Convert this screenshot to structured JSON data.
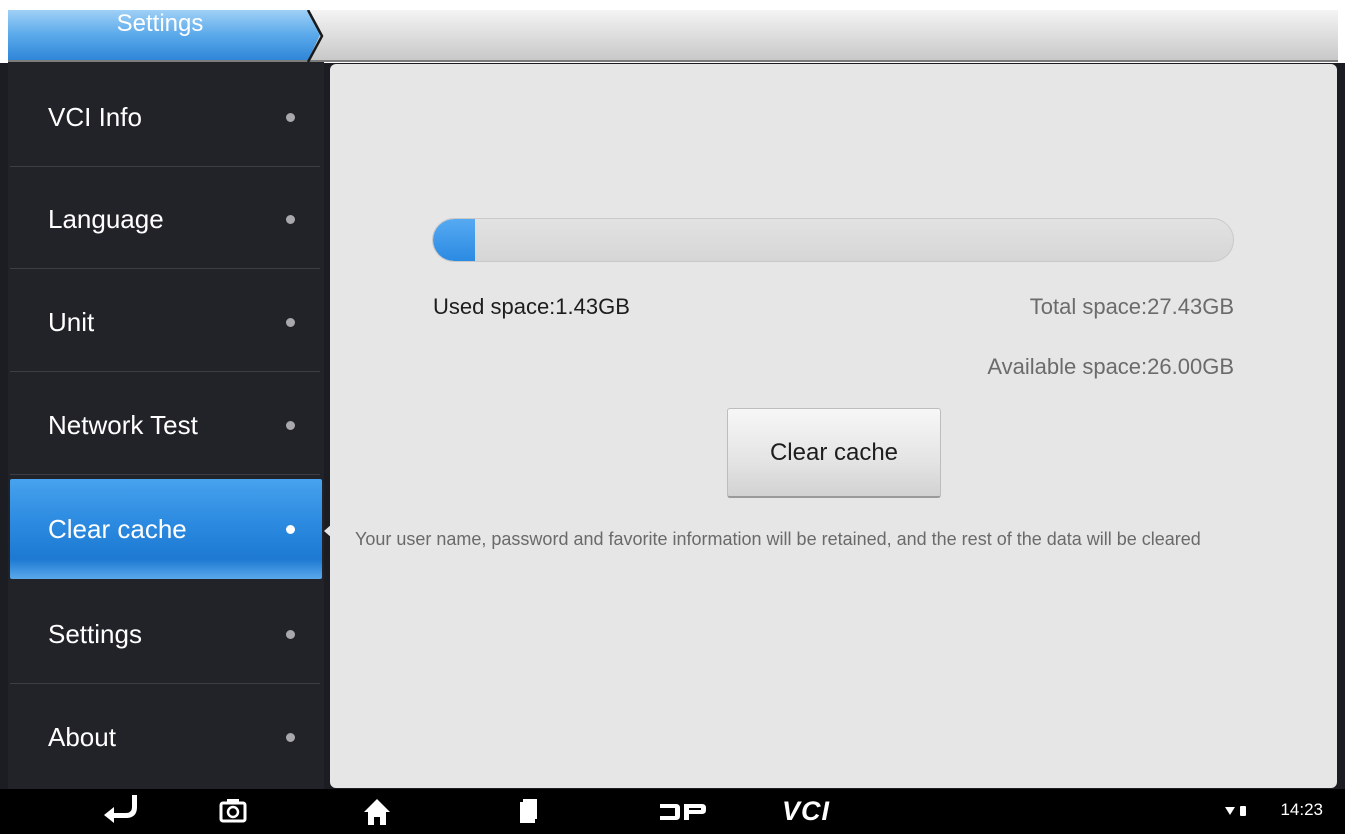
{
  "header": {
    "tab_label": "Settings"
  },
  "sidebar": {
    "items": [
      {
        "label": "VCI Info"
      },
      {
        "label": "Language"
      },
      {
        "label": "Unit"
      },
      {
        "label": "Network Test"
      },
      {
        "label": "Clear cache",
        "active": true
      },
      {
        "label": "Settings"
      },
      {
        "label": "About"
      }
    ]
  },
  "storage": {
    "used_label": "Used space:1.43GB",
    "total_label": "Total space:27.43GB",
    "available_label": "Available space:26.00GB",
    "used_fraction": 0.0521
  },
  "main": {
    "clear_button_label": "Clear cache",
    "info_text": "Your user name, password and favorite information will be retained, and the rest of the data will be cleared"
  },
  "navbar": {
    "icons": [
      "back-icon",
      "screenshot-icon",
      "home-icon",
      "recent-apps-icon",
      "dp-logo-icon",
      "vci-logo-icon"
    ],
    "vci_text": "VCI",
    "time": "14:23"
  },
  "colors": {
    "accent": "#2b8ae0",
    "sidebar_bg": "#222329",
    "main_bg": "#e6e6e6"
  }
}
